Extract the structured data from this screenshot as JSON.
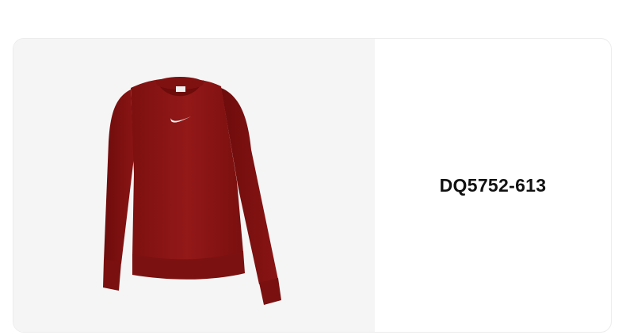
{
  "product": {
    "sku": "DQ5752-613",
    "image": {
      "subject": "sweatshirt-icon",
      "color": "#8f1515",
      "logo": "swoosh-icon"
    }
  },
  "colors": {
    "card_border": "#ececec",
    "image_background": "#f5f5f5",
    "text": "#111111"
  }
}
